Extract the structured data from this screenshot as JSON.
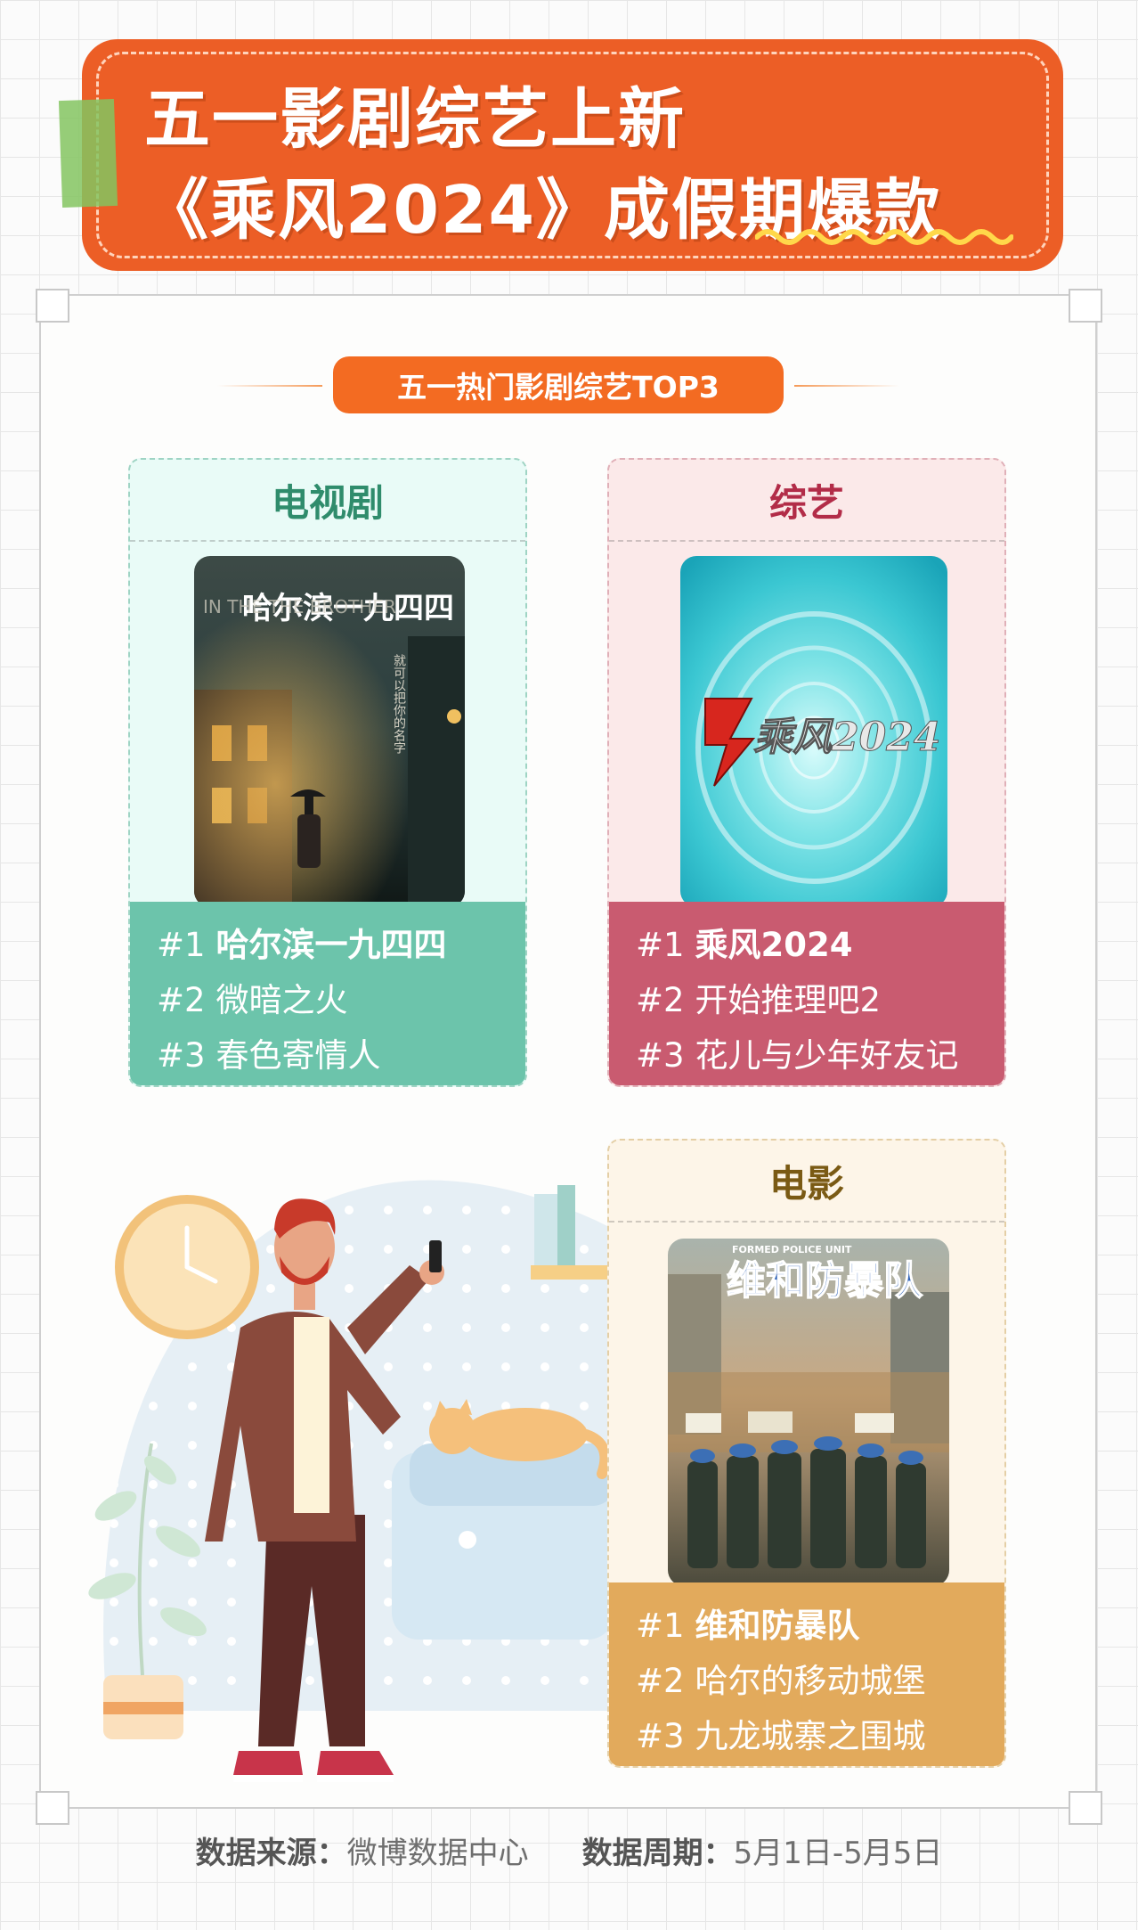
{
  "header": {
    "title_line1": "五一影剧综艺上新",
    "title_line2": "《乘风2024》成假期爆款"
  },
  "section_pill": "五一热门影剧综艺TOP3",
  "categories": [
    {
      "heading": "电视剧",
      "poster_title": "哈尔滨一九四四",
      "poster_side_text": "IN THE     THE BROTHER",
      "ranks": [
        {
          "num": "#1",
          "title": "哈尔滨一九四四"
        },
        {
          "num": "#2",
          "title": "微暗之火"
        },
        {
          "num": "#3",
          "title": "春色寄情人"
        }
      ],
      "colors": {
        "bg": "#e9fbf7",
        "accent": "#6cc4ab",
        "heading": "#2f8c6c"
      }
    },
    {
      "heading": "综艺",
      "poster_title": "乘风2024",
      "ranks": [
        {
          "num": "#1",
          "title": "乘风2024"
        },
        {
          "num": "#2",
          "title": "开始推理吧2"
        },
        {
          "num": "#3",
          "title": "花儿与少年好友记"
        }
      ],
      "colors": {
        "bg": "#fbe9e9",
        "accent": "#c95b70",
        "heading": "#b22c48"
      }
    },
    {
      "heading": "电影",
      "poster_title": "维和防暴队",
      "poster_top_text": "FORMED POLICE UNIT",
      "ranks": [
        {
          "num": "#1",
          "title": "维和防暴队"
        },
        {
          "num": "#2",
          "title": "哈尔的移动城堡"
        },
        {
          "num": "#3",
          "title": "九龙城寨之围城"
        }
      ],
      "colors": {
        "bg": "#fdf5e8",
        "accent": "#e2aa5c",
        "heading": "#7a5a14"
      }
    }
  ],
  "footer": {
    "source_label": "数据来源：",
    "source_value": "微博数据中心",
    "period_label": "数据周期：",
    "period_value": "5月1日-5月5日"
  }
}
